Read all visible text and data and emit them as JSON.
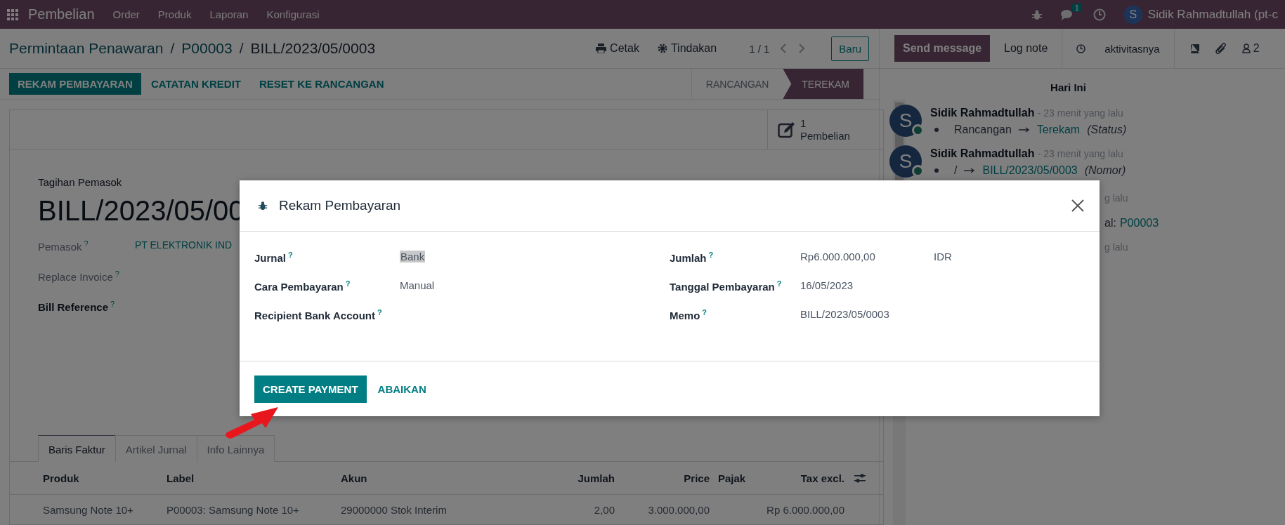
{
  "app_bar": {
    "app_name": "Pembelian",
    "menu": [
      "Order",
      "Produk",
      "Laporan",
      "Konfigurasi"
    ],
    "message_count": "1",
    "user_initial": "S",
    "user": "Sidik Rahmadtullah (pt-c"
  },
  "control_panel": {
    "breadcrumbs": [
      "Permintaan Penawaran",
      "P00003",
      "BILL/2023/05/0003"
    ],
    "breadcrumb_separators": [
      "/",
      "/"
    ],
    "print": "Cetak",
    "actions": "Tindakan",
    "pager": "1 / 1",
    "new_button": "Baru"
  },
  "action_buttons": [
    {
      "label": "REKAM PEMBAYARAN",
      "primary": true
    },
    {
      "label": "CATATAN KREDIT",
      "primary": false
    },
    {
      "label": "RESET KE RANCANGAN",
      "primary": false
    }
  ],
  "statusbar": [
    {
      "label": "RANCANGAN",
      "selected": false
    },
    {
      "label": "TEREKAM",
      "selected": true
    }
  ],
  "smart_button": {
    "count": "1",
    "label": "Pembelian"
  },
  "form": {
    "type_label": "Tagihan Pemasok",
    "title": "BILL/2023/05/00",
    "fields": [
      {
        "label": "Pemasok",
        "help": "?",
        "value": "PT ELEKTRONIK IND",
        "emphasized": false
      },
      {
        "label": "Replace Invoice",
        "help": "?",
        "emphasized": false
      },
      {
        "label": "Bill Reference",
        "help": "?",
        "emphasized": true
      }
    ]
  },
  "tabs": [
    {
      "label": "Baris Faktur",
      "selected": true
    },
    {
      "label": "Artikel Jurnal",
      "selected": false
    },
    {
      "label": "Info Lainnya",
      "selected": false
    }
  ],
  "table": {
    "columns": [
      "Produk",
      "Label",
      "Akun",
      "Jumlah",
      "Price",
      "Pajak",
      "Tax excl."
    ],
    "rows": [
      [
        "Samsung Note 10+",
        "P00003: Samsung Note 10+",
        "29000000 Stok Interim",
        "2,00",
        "3.000.000,00",
        null,
        "Rp 6.000.000,00"
      ]
    ]
  },
  "chatter": {
    "send_message": "Send message",
    "log_note": "Log note",
    "activities": "aktivitasnya",
    "followers": "2",
    "date_separator": "Hari Ini",
    "messages": [
      {
        "initial": "S",
        "author": "Sidik Rahmadtullah",
        "time": "- 23 menit yang lalu",
        "old": "Rancangan",
        "new": "Terekam",
        "field": "(Status)"
      },
      {
        "initial": "S",
        "author": "Sidik Rahmadtullah",
        "time": "- 23 menit yang lalu",
        "old": "/",
        "new": "BILL/2023/05/0003",
        "field": "(Nomor)"
      }
    ],
    "partial_lines": [
      {
        "kind": "time",
        "text": "g lalu"
      },
      {
        "kind": "link",
        "prefix": "al:",
        "text": "P00003"
      },
      {
        "kind": "time",
        "text": "g lalu"
      }
    ]
  },
  "dialog": {
    "title": "Rekam Pembayaran",
    "left_fields": [
      {
        "label": "Jurnal",
        "help": "?",
        "value": "Bank",
        "highlighted": true
      },
      {
        "label": "Cara Pembayaran",
        "help": "?",
        "value": "Manual",
        "highlighted": false
      },
      {
        "label": "Recipient Bank Account",
        "help": "?"
      }
    ],
    "right_fields": [
      {
        "label": "Jumlah",
        "help": "?",
        "value": "Rp6.000.000,00",
        "currency": "IDR"
      },
      {
        "label": "Tanggal Pembayaran",
        "help": "?",
        "value": "16/05/2023"
      },
      {
        "label": "Memo",
        "help": "?",
        "value": "BILL/2023/05/0003"
      }
    ],
    "buttons": [
      {
        "label": "CREATE PAYMENT",
        "primary": true
      },
      {
        "label": "ABAIKAN",
        "primary": false
      }
    ]
  }
}
